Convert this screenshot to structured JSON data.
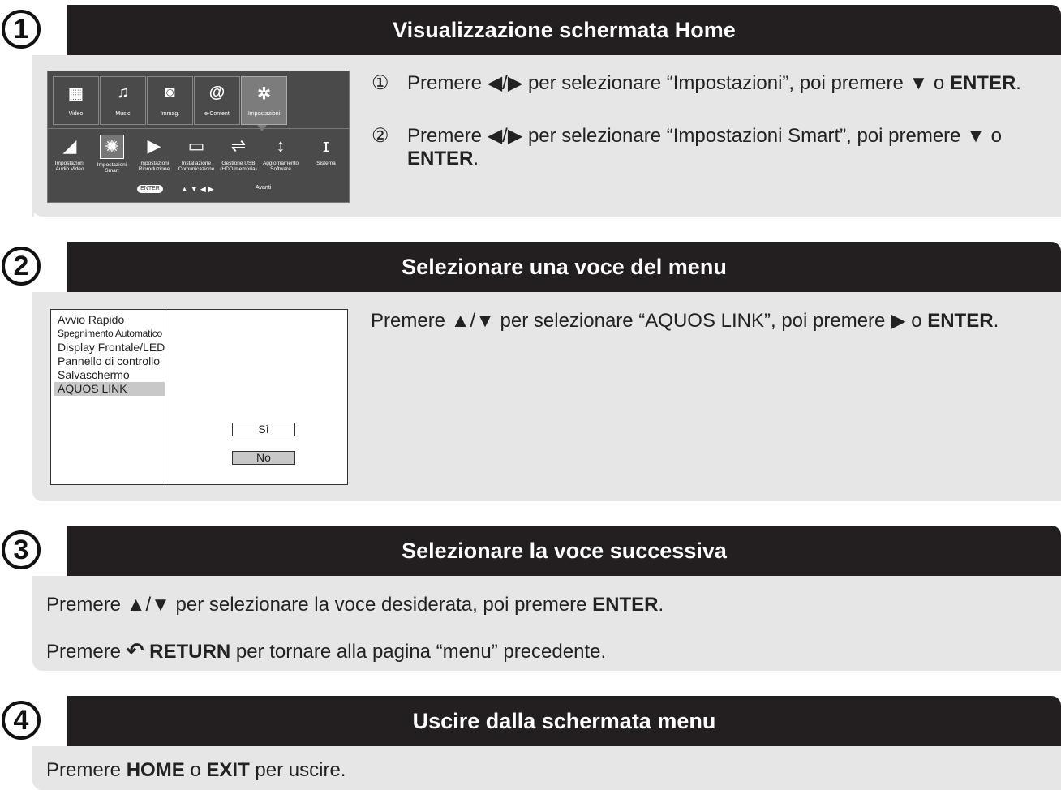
{
  "steps": [
    {
      "number": "1",
      "title": "Visualizzazione schermata Home"
    },
    {
      "number": "2",
      "title": "Selezionare una voce del menu"
    },
    {
      "number": "3",
      "title": "Selezionare la voce successiva"
    },
    {
      "number": "4",
      "title": "Uscire dalla schermata menu"
    }
  ],
  "step1": {
    "items": [
      {
        "marker": "①",
        "pre": "Premere ◀/▶ per selezionare “Impostazioni”, poi premere ▼ o",
        "bold": "ENTER",
        "post": "."
      },
      {
        "marker": "②",
        "pre": "Premere ◀/▶ per selezionare “Impostazioni Smart”, poi premere ▼ o",
        "bold": "ENTER",
        "post": "."
      }
    ],
    "home": {
      "tiles": [
        {
          "icon": "▦",
          "label": "Video"
        },
        {
          "icon": "♫",
          "label": "Music"
        },
        {
          "icon": "◙",
          "label": "Immag."
        },
        {
          "icon": "@",
          "label": "e-Content"
        },
        {
          "icon": "✲",
          "label": "Impostazioni"
        }
      ],
      "subs": [
        {
          "icon": "◢",
          "label": "Impostazioni Audio Video"
        },
        {
          "icon": "✺",
          "label": "Impostazioni Smart"
        },
        {
          "icon": "▶",
          "label": "Impostazioni Riproduzione"
        },
        {
          "icon": "▭",
          "label": "Installazione Comunicazione"
        },
        {
          "icon": "⇌",
          "label": "Gestione USB (HDD/memoria)"
        },
        {
          "icon": "↕",
          "label": "Aggiornamento Software"
        },
        {
          "icon": "ɪ",
          "label": "Sistema"
        }
      ],
      "enter": "ENTER",
      "dots": "▲▼◀▶",
      "next": "Avanti"
    }
  },
  "step2": {
    "text_pre": "Premere ▲/▼ per selezionare “AQUOS LINK”, poi premere ▶ o",
    "text_bold": "ENTER",
    "text_post": ".",
    "menu_items": [
      "Avvio Rapido",
      "Spegnimento Automatico",
      "Display Frontale/LED",
      "Pannello di controllo",
      "Salvaschermo",
      "AQUOS LINK"
    ],
    "options": [
      "Sì",
      "No"
    ]
  },
  "step3": {
    "line1_pre": "Premere ▲/▼ per selezionare la voce desiderata, poi premere",
    "line1_bold": "ENTER",
    "line1_post": ".",
    "line2_pre": "Premere",
    "line2_icon": "↶",
    "line2_bold": "RETURN",
    "line2_post": "per tornare alla pagina “menu” precedente."
  },
  "step4": {
    "pre": "Premere",
    "bold1": "HOME",
    "mid": "o",
    "bold2": "EXIT",
    "post": "per uscire."
  }
}
